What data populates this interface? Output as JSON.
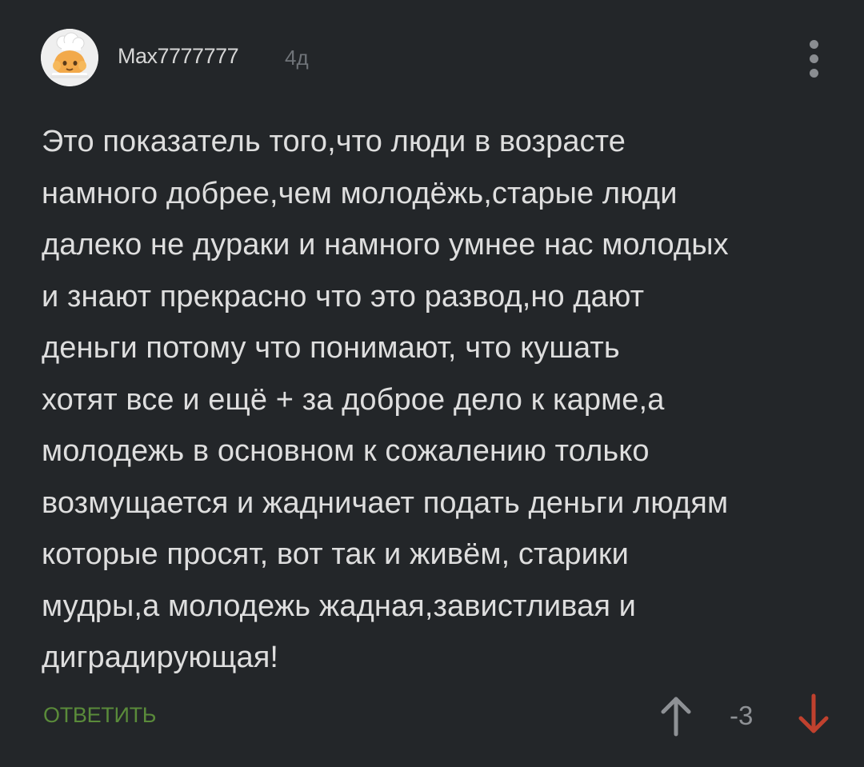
{
  "comment": {
    "author": "Max7777777",
    "age": "4д",
    "avatar_icon": "chef-hat-avatar-icon",
    "menu_icon": "more-vertical-icon",
    "text": "Это показатель того,что люди в возрасте\nнамного добрее,чем молодёжь,старые люди\nдалеко не дураки и намного умнее нас молодых\nи знают прекрасно что это развод,но дают\nденьги потому что понимают, что кушать\nхотят все и ещё + за доброе дело к карме,а\nмолодежь в основном к сожалению только\nвозмущается и жадничает подать деньги людям\nкоторые просят, вот так и живём, старики\nмудры,а молодежь жадная,завистливая и\nдиградирующая!"
  },
  "actions": {
    "reply_label": "ОТВЕТИТЬ",
    "rating": "-3",
    "upvote_icon": "arrow-up-icon",
    "downvote_icon": "arrow-down-icon"
  },
  "colors": {
    "background": "#232629",
    "text": "#dedede",
    "muted": "#6f7378",
    "reply": "#5a8b3a",
    "downvote_active": "#c0412e",
    "upvote": "#8e9195"
  }
}
